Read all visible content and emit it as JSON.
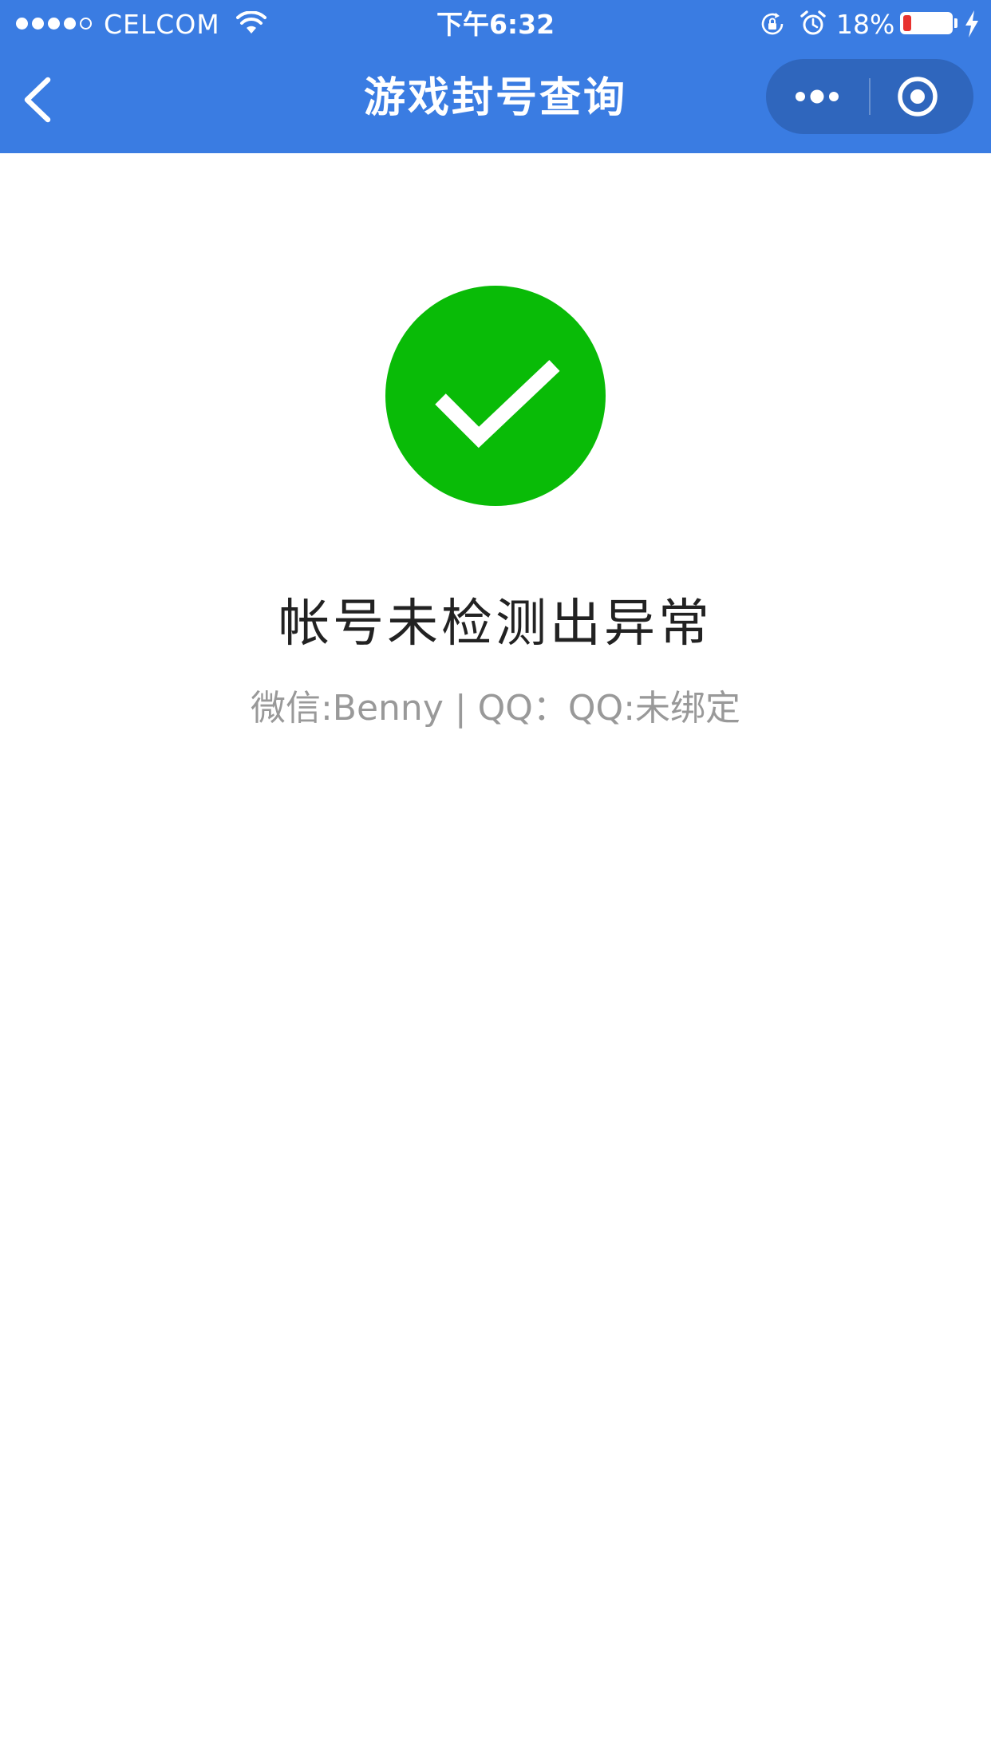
{
  "status_bar": {
    "carrier": "CELCOM",
    "time": "下午6:32",
    "battery_percent_text": "18%",
    "battery_level": 0.18,
    "signal_bars_filled": 4,
    "signal_bars_total": 5
  },
  "nav": {
    "title": "游戏封号查询",
    "back_icon": "chevron-left-icon",
    "menu_icon": "more-dots-icon",
    "close_icon": "target-circle-icon"
  },
  "result": {
    "icon": "success-check-icon",
    "title": "帐号未检测出异常",
    "subtitle": "微信:Benny | QQ：QQ:未绑定"
  },
  "colors": {
    "nav_background": "#3a7ce2",
    "capsule_background": "#2f66bd",
    "success_green": "#09bb07",
    "battery_low": "#e8322f",
    "title_text": "#222222",
    "subtitle_text": "#999999"
  }
}
